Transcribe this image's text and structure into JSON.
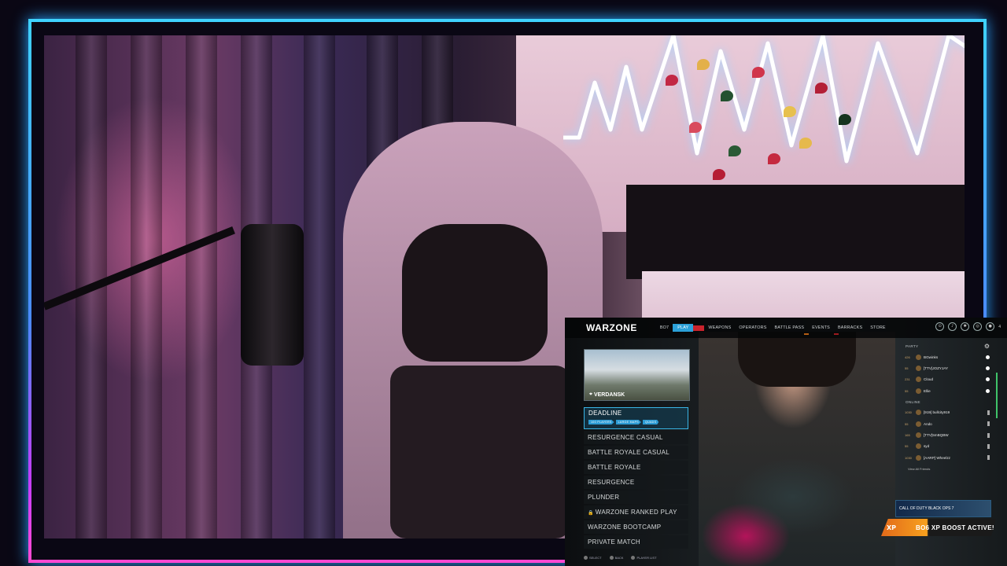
{
  "game": {
    "logo": "WARZONE",
    "nav": [
      "",
      "BO7",
      "PLAY",
      "",
      "WEAPONS",
      "OPERATORS",
      "BATTLE PASS",
      "EVENTS",
      "BARRACKS",
      "STORE"
    ],
    "active_nav": "PLAY",
    "map": {
      "name": "VERDANSK"
    },
    "modes": [
      {
        "label": "DEADLINE",
        "tags": [
          "100 PLAYERS",
          "LARGE MAPS",
          "QUADS"
        ],
        "selected": true
      },
      {
        "label": "RESURGENCE CASUAL"
      },
      {
        "label": "BATTLE ROYALE CASUAL"
      },
      {
        "label": "BATTLE ROYALE"
      },
      {
        "label": "RESURGENCE"
      },
      {
        "label": "PLUNDER"
      },
      {
        "label": "WARZONE RANKED PLAY",
        "locked": true
      },
      {
        "label": "WARZONE BOOTCAMP"
      },
      {
        "label": "PRIVATE MATCH"
      }
    ],
    "footer": [
      "SELECT",
      "BACK",
      "PLAYER LIST"
    ],
    "social": {
      "party_label": "PARTY",
      "party": [
        {
          "level": "426",
          "name": "BGwinks"
        },
        {
          "level": "55",
          "name": "[TTV]JOZYJAY"
        },
        {
          "level": "231",
          "name": "Cloud"
        },
        {
          "level": "55",
          "name": "Ellie"
        }
      ],
      "online_label": "ONLINE",
      "online": [
        {
          "level": "1030",
          "name": "[919] bullcity919"
        },
        {
          "level": "55",
          "name": "Ando"
        },
        {
          "level": "165",
          "name": "[TTV]5mBQBW"
        },
        {
          "level": "55",
          "name": "syd"
        },
        {
          "level": "1030",
          "name": "[AARP] Wheelzz"
        }
      ],
      "view_all": "View All Friends"
    },
    "promo": "CALL OF DUTY BLACK OPS 7",
    "boost": "BO6 XP BOOST ACTIVE!",
    "level_badge": "4"
  }
}
